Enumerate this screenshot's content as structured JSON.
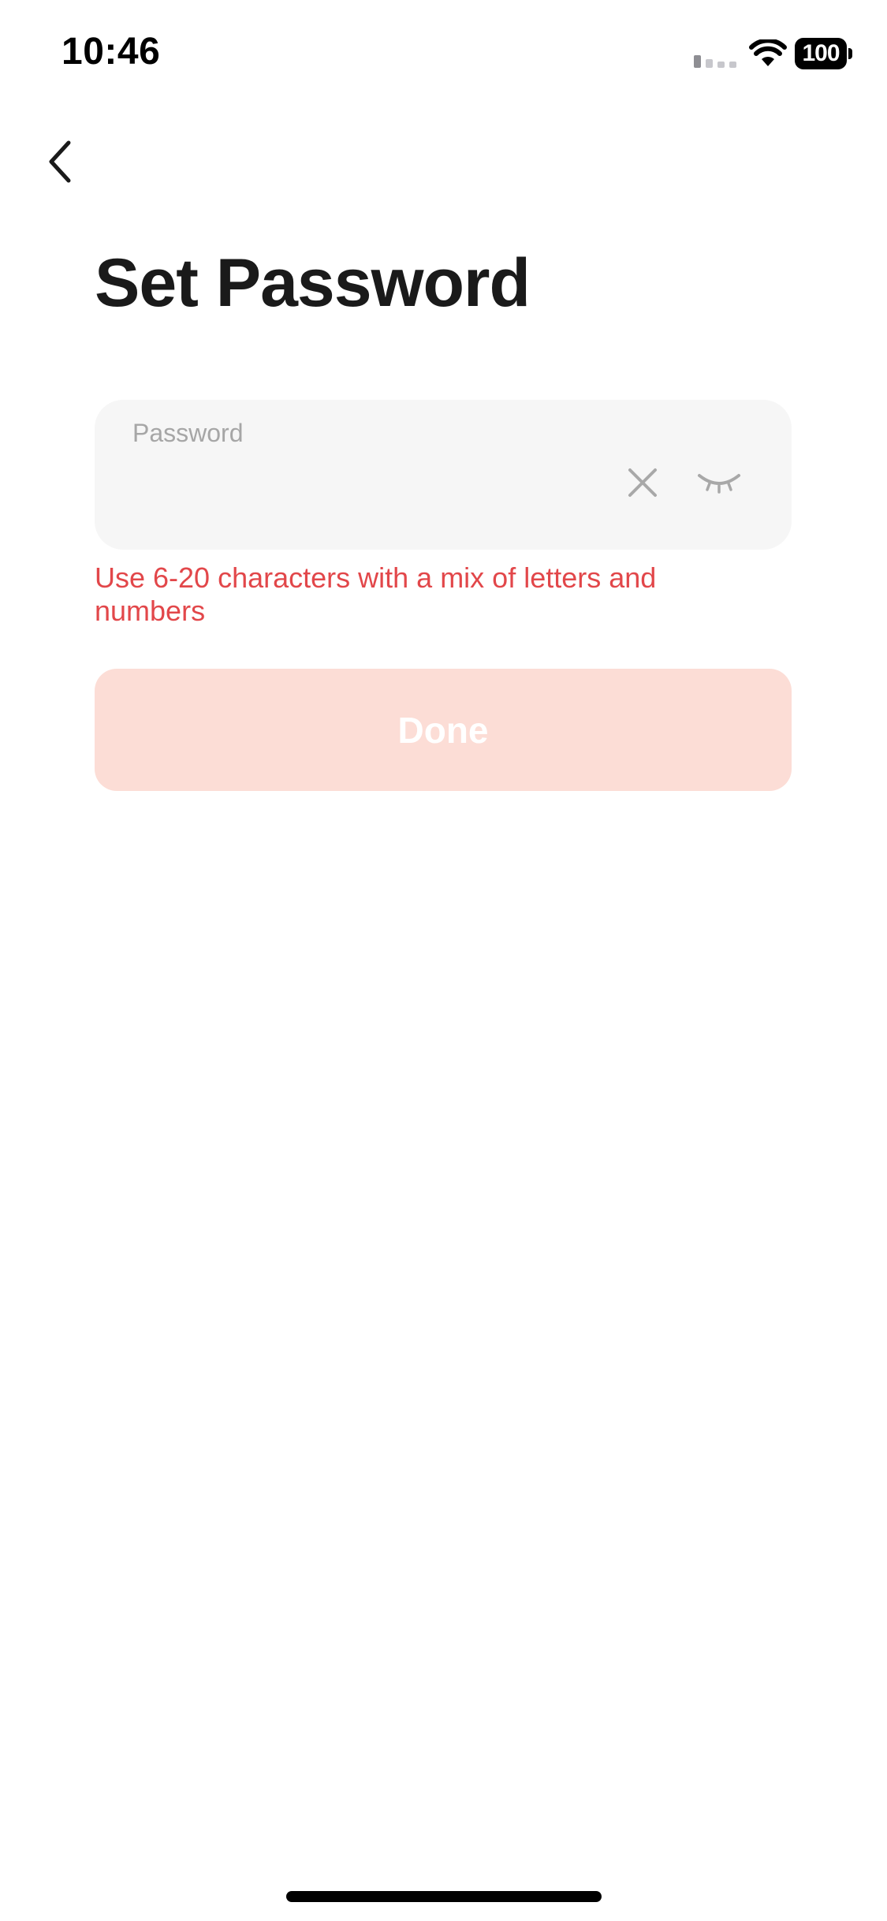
{
  "status_bar": {
    "time": "10:46",
    "battery_level": "100",
    "signal_icon": "cellular-signal-icon",
    "wifi_icon": "wifi-icon"
  },
  "nav": {
    "back_icon": "chevron-left-icon"
  },
  "title": "Set Password",
  "password_field": {
    "label": "Password",
    "value": "",
    "clear_icon": "close-icon",
    "visibility_icon": "eye-closed-icon"
  },
  "hint": "Use 6-20 characters with a mix of letters and numbers",
  "done_button": {
    "label": "Done",
    "enabled": false
  },
  "colors": {
    "accent_disabled": "#fcddd6",
    "error": "#e2474a",
    "field_background": "#f6f6f6"
  }
}
